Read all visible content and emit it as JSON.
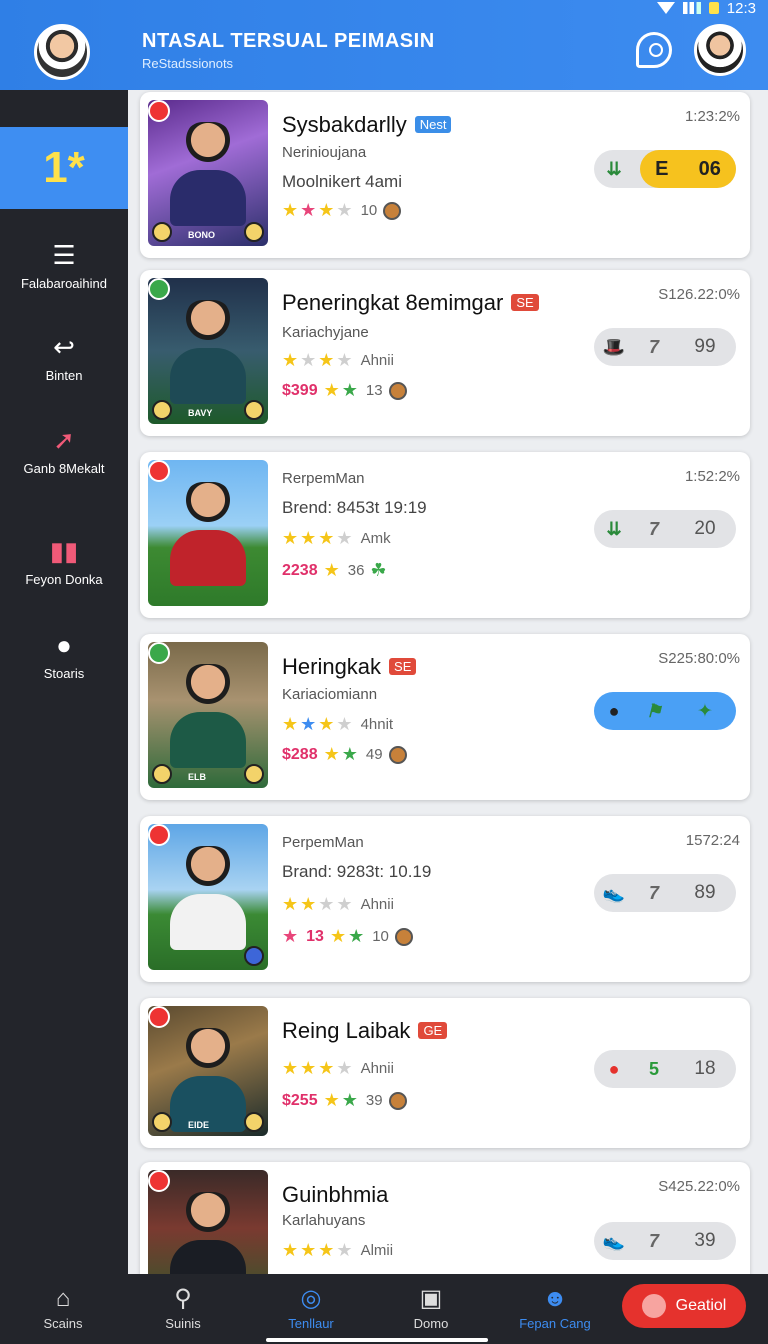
{
  "status_bar": {
    "time": "12:3"
  },
  "header": {
    "title": "NTASAL TERSUAL PEIMASIN",
    "subtitle": "ReStadssionots",
    "avatar_icon": "user-avatar-icon",
    "support_icon": "chat-support-icon",
    "profile_icon": "profile-avatar-icon",
    "accent": "#3d8cf0"
  },
  "sidebar": {
    "active_icon": "trophy-star-icon",
    "items": [
      {
        "label": "Falabaroaihind",
        "icon": "book-icon"
      },
      {
        "label": "Binten",
        "icon": "share-icon"
      },
      {
        "label": "Ganb 8Mekalt",
        "icon": "arrow-up-icon"
      },
      {
        "label": "Feyon Donka",
        "icon": "chart-icon"
      },
      {
        "label": "Stoaris",
        "icon": "smile-icon"
      }
    ]
  },
  "cards": [
    {
      "title": "Sysbakdarlly",
      "badge": "Nest",
      "percent": "1:23:2%",
      "line2": "Nerinioujana",
      "line3": "Moolnikert 4ami",
      "rating_text": "10",
      "pill": {
        "num": "06",
        "mid": "E",
        "style": "yellow"
      },
      "thumb_caption": "BONO"
    },
    {
      "title": "Peneringkat 8emimgar",
      "badge": "SE",
      "percent": "S126.22:0%",
      "line2": "Kariachyjane",
      "line3": "Ahnii",
      "price": "$399",
      "rating_text": "13",
      "pill": {
        "num": "99",
        "mid": "7",
        "style": "grey"
      },
      "thumb_caption": "BAVY"
    },
    {
      "title": "",
      "badge": "",
      "percent": "1:52:2%",
      "line2": "RerpemMan",
      "line3": "Brend: 8453t 19:19",
      "line4": "Amk",
      "price": "2238",
      "rating_text": "36",
      "pill": {
        "num": "20",
        "mid": "7",
        "style": "grey"
      },
      "thumb_caption": ""
    },
    {
      "title": "Heringkak",
      "badge": "SE",
      "percent": "S225:80:0%",
      "line2": "Kariaciomiann",
      "line3": "4hnit",
      "price": "$288",
      "rating_text": "49",
      "pill": {
        "num": "",
        "mid": "",
        "style": "blue"
      },
      "thumb_caption": "ELB"
    },
    {
      "title": "",
      "badge": "",
      "percent": "1572:24",
      "line2": "PerpemMan",
      "line3": "Brand: 9283t: 10.19",
      "line4": "Ahnii",
      "price": "13",
      "rating_text": "10",
      "pill": {
        "num": "89",
        "mid": "7",
        "style": "grey"
      },
      "thumb_caption": ""
    },
    {
      "title": "Reing Laibak",
      "badge": "GE",
      "percent": "",
      "line2": "",
      "line3": "Ahnii",
      "price": "$255",
      "rating_text": "39",
      "pill": {
        "num": "18",
        "mid": "5",
        "style": "grey"
      },
      "thumb_caption": "EIDE"
    },
    {
      "title": "Guinbhmia",
      "badge": "",
      "percent": "S425.22:0%",
      "line2": "Karlahuyans",
      "line3": "Almii",
      "rating_text": "",
      "pill": {
        "num": "39",
        "mid": "7",
        "style": "grey"
      },
      "thumb_caption": ""
    }
  ],
  "bottom_nav": [
    {
      "label": "Scains",
      "icon": "home-icon"
    },
    {
      "label": "Suinis",
      "icon": "person-icon"
    },
    {
      "label": "Tenllaur",
      "icon": "target-icon"
    },
    {
      "label": "Domo",
      "icon": "camera-icon"
    },
    {
      "label": "Fepan Cang",
      "icon": "avatar-icon"
    }
  ],
  "cta": {
    "label": "Geatiol",
    "color": "#e5322d"
  }
}
